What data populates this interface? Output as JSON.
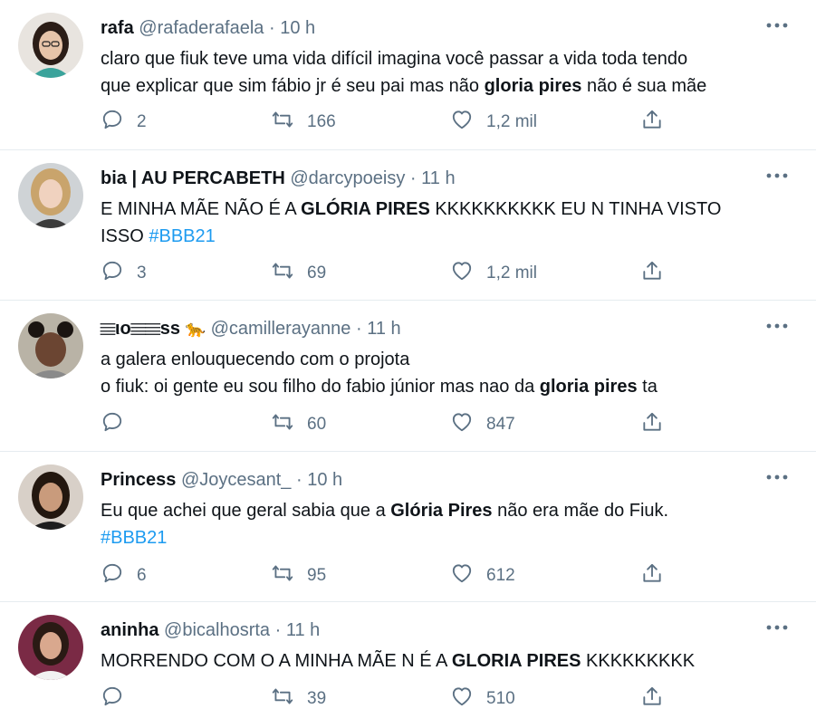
{
  "tweets": [
    {
      "name": "rafa",
      "handle": "@rafaderafaela",
      "sep": "·",
      "time": "10 h",
      "lines": [
        [
          {
            "t": "claro que fiuk teve uma vida difícil imagina você passar a vida toda tendo",
            "s": "normal"
          }
        ],
        [
          {
            "t": "que explicar que sim fábio jr é seu pai mas não ",
            "s": "normal"
          },
          {
            "t": "gloria pires",
            "s": "bold"
          },
          {
            "t": " não é sua mãe",
            "s": "normal"
          }
        ]
      ],
      "replies": "2",
      "retweets": "166",
      "likes": "1,2 mil"
    },
    {
      "name": "bia | AU PERCABETH",
      "handle": "@darcypoeisy",
      "sep": "·",
      "time": "11 h",
      "lines": [
        [
          {
            "t": "E MINHA MÃE NÃO É A ",
            "s": "normal"
          },
          {
            "t": "GLÓRIA PIRES",
            "s": "bold"
          },
          {
            "t": " KKKKKKKKKK EU N TINHA VISTO",
            "s": "normal"
          }
        ],
        [
          {
            "t": "ISSO ",
            "s": "normal"
          },
          {
            "t": "#BBB21",
            "s": "hash"
          }
        ]
      ],
      "replies": "3",
      "retweets": "69",
      "likes": "1,2 mil"
    },
    {
      "name": "𝄙ιο𝄙𝄙ss",
      "name_emoji": "🐆",
      "handle": "@camillerayanne",
      "sep": "·",
      "time": "11 h",
      "lines": [
        [
          {
            "t": "a galera enlouquecendo com o projota",
            "s": "normal"
          }
        ],
        [
          {
            "t": "o fiuk: oi gente eu sou filho do fabio júnior mas nao da ",
            "s": "normal"
          },
          {
            "t": "gloria pires",
            "s": "bold"
          },
          {
            "t": " ta",
            "s": "normal"
          }
        ]
      ],
      "replies": "",
      "retweets": "60",
      "likes": "847"
    },
    {
      "name": "Princess",
      "handle": "@Joycesant_",
      "sep": "·",
      "time": "10 h",
      "lines": [
        [
          {
            "t": "Eu que achei que geral sabia que a ",
            "s": "normal"
          },
          {
            "t": "Glória Pires",
            "s": "bold"
          },
          {
            "t": " não era mãe do Fiuk.",
            "s": "normal"
          }
        ],
        [
          {
            "t": "#BBB21",
            "s": "hash"
          }
        ]
      ],
      "replies": "6",
      "retweets": "95",
      "likes": "612"
    },
    {
      "name": "aninha",
      "handle": "@bicalhosrta",
      "sep": "·",
      "time": "11 h",
      "lines": [
        [
          {
            "t": "MORRENDO COM O A MINHA MÃE N É A ",
            "s": "normal"
          },
          {
            "t": "GLORIA PIRES",
            "s": "bold"
          },
          {
            "t": " KKKKKKKKK",
            "s": "normal"
          }
        ]
      ],
      "replies": "",
      "retweets": "39",
      "likes": "510"
    }
  ],
  "icons": {
    "reply": "reply-icon",
    "retweet": "retweet-icon",
    "like": "heart-icon",
    "share": "share-icon",
    "more": "more-options-icon"
  },
  "colors": {
    "text": "#0f1419",
    "muted": "#5b7083",
    "hashtag": "#1d9bf0",
    "divider": "#e6ecf0"
  }
}
